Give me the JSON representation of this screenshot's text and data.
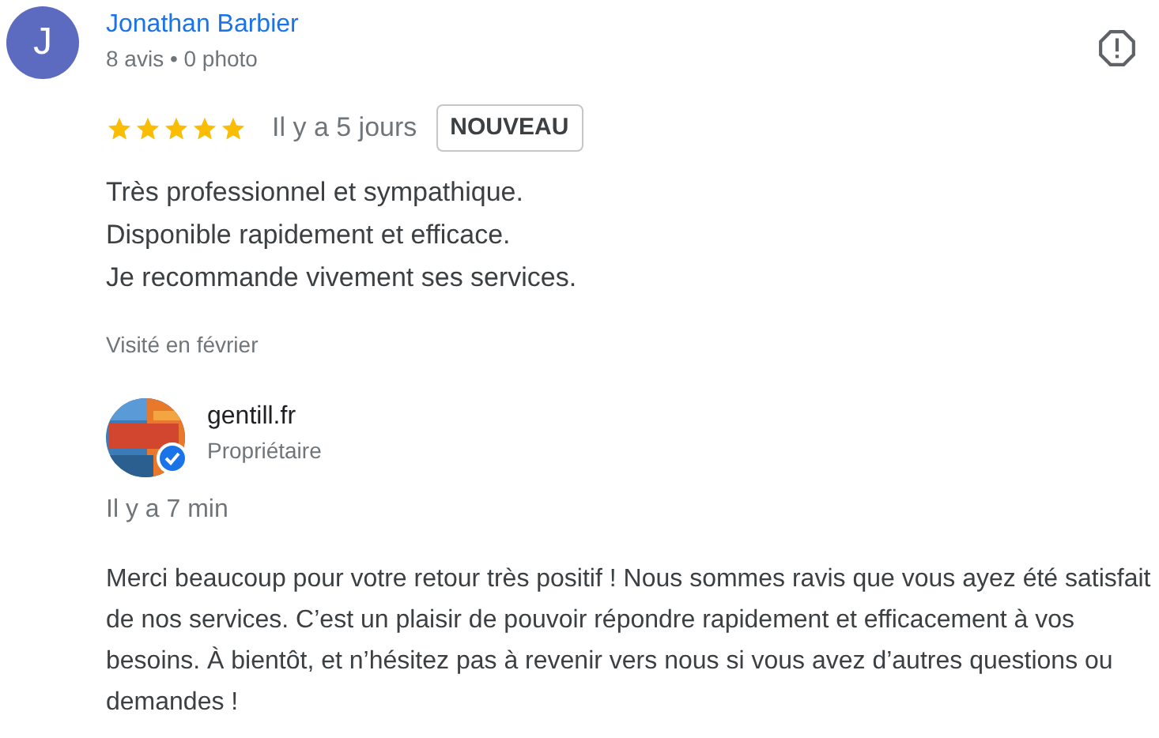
{
  "review": {
    "avatar_letter": "J",
    "author": "Jonathan Barbier",
    "meta": "8 avis • 0 photo",
    "stars": 5,
    "time": "Il y a 5 jours",
    "badge": "NOUVEAU",
    "lines": [
      "Très professionnel et sympathique.",
      "Disponible rapidement et efficace.",
      "Je recommande vivement ses services."
    ],
    "visited": "Visité en février"
  },
  "reply": {
    "owner": "gentill.fr",
    "verified": true,
    "role": "Propriétaire",
    "time": "Il y a 7 min",
    "text": "Merci beaucoup pour votre retour très positif ! Nous sommes ravis que vous ayez été satisfait de nos services. C’est un plaisir de pouvoir répondre rapidement et efficacement à vos besoins. À bientôt, et n’hésitez pas à revenir vers nous si vous avez d’autres questions ou demandes !"
  }
}
